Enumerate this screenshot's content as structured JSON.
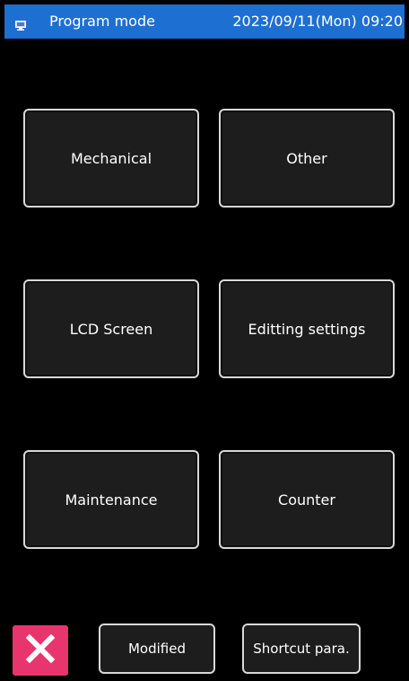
{
  "status_bar": {
    "title": "Program mode",
    "datetime": "2023/09/11(Mon) 09:20",
    "icon": "monitor-icon"
  },
  "menu": {
    "items": [
      {
        "label": "Mechanical"
      },
      {
        "label": "Other"
      },
      {
        "label": "LCD Screen"
      },
      {
        "label": "Editting settings"
      },
      {
        "label": "Maintenance"
      },
      {
        "label": "Counter"
      }
    ]
  },
  "footer": {
    "close_icon": "close-icon",
    "modified_label": "Modified",
    "shortcut_label": "Shortcut para."
  },
  "colors": {
    "title_bar": "#1e6fd2",
    "background": "#000000",
    "button_fill": "#1d1d1d",
    "button_border": "#d8d8d8",
    "close_button": "#e8356e"
  }
}
